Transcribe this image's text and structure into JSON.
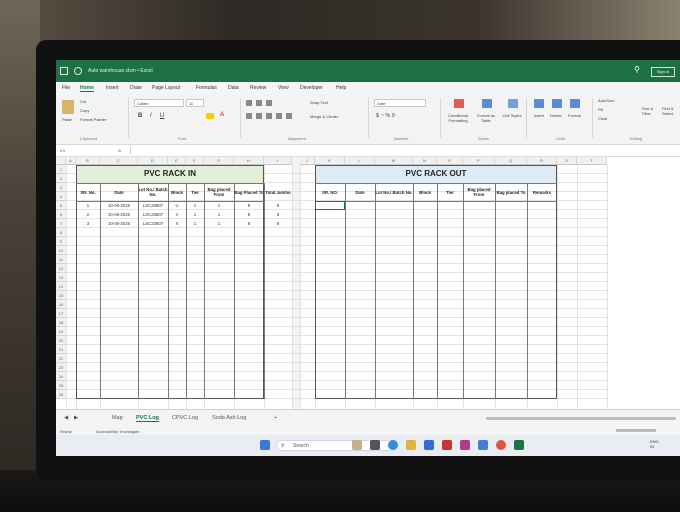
{
  "window": {
    "title": "Auto warehouse.xlsm  •  Excel",
    "sign_in": "Sign in"
  },
  "menu": [
    "File",
    "Home",
    "Insert",
    "Draw",
    "Page Layout",
    "Formulas",
    "Data",
    "Review",
    "View",
    "Developer",
    "Help"
  ],
  "ribbon": {
    "paste": "Paste",
    "cut": "Cut",
    "copy": "Copy",
    "format_painter": "Format Painter",
    "clipboard_group": "Clipboard",
    "font_name": "Calibri",
    "font_size": "11",
    "font_group": "Font",
    "wrap_text": "Wrap Text",
    "merge_center": "Merge & Center",
    "alignment_group": "Alignment",
    "number_format": "Date",
    "number_group": "Number",
    "conditional_formatting": "Conditional Formatting",
    "format_as_table": "Format as Table",
    "cell_styles": "Cell Styles",
    "styles_group": "Styles",
    "insert": "Insert",
    "delete": "Delete",
    "format": "Format",
    "cells_group": "Cells",
    "autosum": "AutoSum",
    "fill": "Fill",
    "clear": "Clear",
    "sort_filter": "Sort & Filter",
    "find_select": "Find & Select",
    "editing_group": "Editing"
  },
  "formula_bar": {
    "name_box": "K4",
    "fx": "fx"
  },
  "columns_left": [
    "A",
    "B",
    "C",
    "D",
    "E",
    "F",
    "G",
    "H",
    "I"
  ],
  "columns_right": [
    "J",
    "K",
    "L",
    "M",
    "N",
    "O",
    "P",
    "Q",
    "R",
    "S",
    "T"
  ],
  "rows": [
    "1",
    "2",
    "3",
    "4",
    "5",
    "6",
    "7",
    "8",
    "9",
    "10",
    "11",
    "12",
    "13",
    "14",
    "15",
    "16",
    "17",
    "18",
    "19",
    "20",
    "21",
    "22",
    "23",
    "24",
    "25",
    "26"
  ],
  "rack_in": {
    "title": "PVC RACK IN",
    "headers": [
      "SR. No.",
      "Date",
      "Lot No./ Batch No.",
      "Block",
      "Tier",
      "Bag placed From",
      "Bag Placed To",
      "Total Jumbo"
    ],
    "rows": [
      [
        "1",
        "10-06-2026",
        "LSC23807",
        "U",
        "1",
        "1",
        "8",
        "8"
      ],
      [
        "2",
        "10-06-2026",
        "LSC23807",
        "V",
        "1",
        "1",
        "8",
        "8"
      ],
      [
        "3",
        "10-06-2026",
        "LSC23807",
        "X",
        "1",
        "1",
        "8",
        "8"
      ]
    ]
  },
  "rack_out": {
    "title": "PVC RACK OUT",
    "headers": [
      "SR. NO.",
      "Date",
      "Lot No./ Batch No.",
      "Block",
      "Tier",
      "Bag placed From",
      "Bag placed To",
      "Remarks"
    ]
  },
  "sheet_tabs": [
    "Map",
    "PVC Log",
    "CPVC Log",
    "Soda Ash Log"
  ],
  "active_tab": "PVC Log",
  "status": {
    "ready": "Ready",
    "accessibility": "Accessibility: Investigate"
  },
  "taskbar": {
    "search_placeholder": "Search",
    "lang": "ENG",
    "region": "IN"
  },
  "colors": {
    "excel_green": "#1e7145",
    "rack_in_fill": "#e2efda",
    "rack_out_fill": "#ddebf7"
  }
}
